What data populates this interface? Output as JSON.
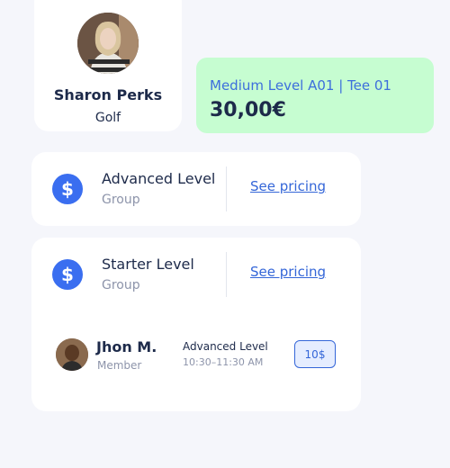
{
  "profile": {
    "name": "Sharon Perks",
    "sport": "Golf"
  },
  "highlight": {
    "title": "Medium Level A01 | Tee 01",
    "price": "30,00€"
  },
  "levels": [
    {
      "title": "Advanced Level",
      "subtitle": "Group",
      "link": "See pricing"
    },
    {
      "title": "Starter Level",
      "subtitle": "Group",
      "link": "See pricing"
    }
  ],
  "member": {
    "name": "Jhon M.",
    "role": "Member",
    "session_level": "Advanced Level",
    "session_time": "10:30–11:30 AM",
    "price": "10$"
  },
  "icons": {
    "price": "dollar-icon",
    "glyph": "$"
  },
  "colors": {
    "accent": "#3a6ef0",
    "highlight_bg": "#c6fdd1",
    "text_dark": "#1d2a4a"
  }
}
